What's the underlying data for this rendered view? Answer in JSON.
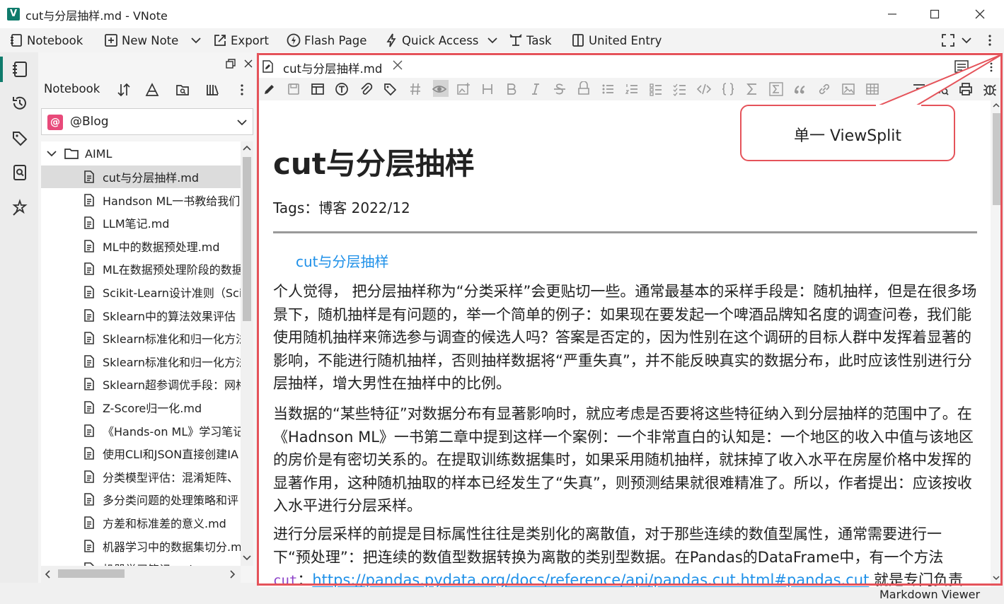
{
  "window": {
    "title": "cut与分层抽样.md - VNote",
    "logo_letter": "V"
  },
  "toolbar": {
    "notebook": "Notebook",
    "new_note": "New Note",
    "export": "Export",
    "flash_page": "Flash Page",
    "quick_access": "Quick Access",
    "task": "Task",
    "united_entry": "United Entry"
  },
  "notebook_panel": {
    "label": "Notebook",
    "selected_notebook": "@Blog",
    "notebook_icon_letter": "@",
    "folder": "AIML",
    "files": [
      "cut与分层抽样.md",
      "Handson ML一书教给我们",
      "LLM笔记.md",
      "ML中的数据预处理.md",
      "ML在数据预处理阶段的数据",
      "Scikit-Learn设计准则（Sci",
      "Sklearn中的算法效果评估",
      "Sklearn标准化和归一化方法",
      "Sklearn标准化和归一化方法",
      "Sklearn超参调优手段：网格",
      "Z-Score归一化.md",
      "《Hands-on ML》学习笔记",
      "使用CLI和JSON直接创建IA",
      "分类模型评估：混淆矩阵、",
      "多分类问题的处理策略和评",
      "方差和标准差的意义.md",
      "机器学习中的数据集切分.m",
      "机器学习笔记.md"
    ]
  },
  "editor": {
    "tab_title": "cut与分层抽样.md",
    "doc_title": "cut与分层抽样",
    "tags": "Tags：博客 2022/12",
    "toc_link": "cut与分层抽样",
    "paragraphs": [
      "个人觉得， 把分层抽样称为“分类采样”会更贴切一些。通常最基本的采样手段是：随机抽样，但是在很多场景下，随机抽样是有问题的，举一个简单的例子：如果现在要发起一个啤酒品牌知名度的调查问卷，我们能使用随机抽样来筛选参与调查的候选人吗？答案是否定的，因为性别在这个调研的目标人群中发挥着显著的影响，不能进行随机抽样，否则抽样数据将“严重失真”，并不能反映真实的数据分布，此时应该性别进行分层抽样，增大男性在抽样中的比例。",
      "当数据的“某些特征”对数据分布有显著影响时，就应考虑是否要将这些特征纳入到分层抽样的范围中了。在《Hadnson ML》一书第二章中提到这样一个案例：一个非常直白的认知是：一个地区的收入中值与该地区的房价是有密切关系的。在提取训练数据集时，如果采用随机抽样，就抹掉了收入水平在房屋价格中发挥的显著作用，这种随机抽取的样本已经发生了“失真”，则预测结果就很难精准了。所以，作者提出：应该按收入水平进行分层采样。",
      "进行分层采样的前提是目标属性往往是类别化的离散值，对于那些连续的数值型属性，通常需要进行一下“预处理”：把连续的数值型数据转换为离散的类别型数据。在Pandas的DataFrame中，有一个方法"
    ],
    "p3_code": "cut",
    "p3_colon": "：",
    "p3_link": "https://pandas.pydata.org/docs/reference/api/pandas.cut.html#pandas.cut",
    "p3_tail": " 就是专门负责这种处理"
  },
  "annotation": {
    "callout": "单一 ViewSplit",
    "color": "#e5535a"
  },
  "status_bar": {
    "mode": "Markdown Viewer"
  },
  "colors": {
    "accent": "#0f7b6c",
    "link": "#1e90e8",
    "code": "#8b3fc7"
  }
}
